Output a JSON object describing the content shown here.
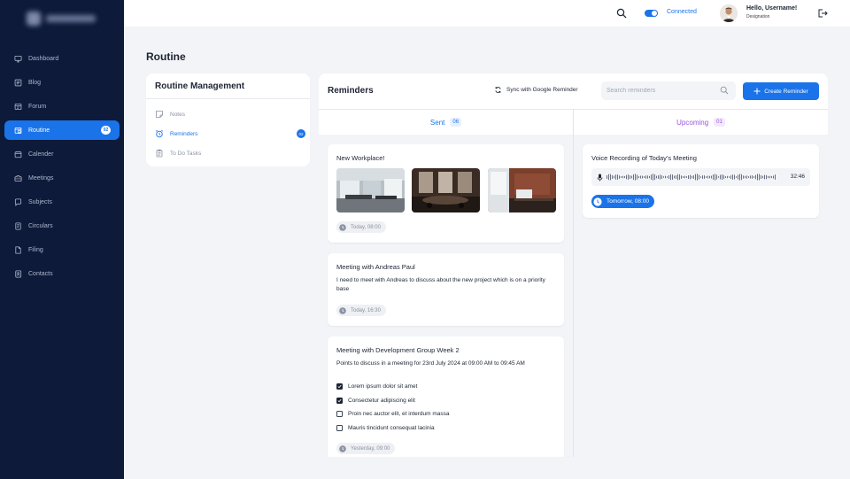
{
  "sidebar": {
    "items": [
      {
        "label": "Dashboard"
      },
      {
        "label": "Blog"
      },
      {
        "label": "Forum"
      },
      {
        "label": "Routine",
        "badge": "02"
      },
      {
        "label": "Calender"
      },
      {
        "label": "Meetings"
      },
      {
        "label": "Subjects"
      },
      {
        "label": "Circulars"
      },
      {
        "label": "Filing"
      },
      {
        "label": "Contacts"
      }
    ]
  },
  "topbar": {
    "status": "Connected",
    "user_greeting": "Hello, Username!",
    "user_role": "Designation"
  },
  "page": {
    "title": "Routine"
  },
  "routine_mgmt": {
    "title": "Routine Management",
    "items": [
      {
        "label": "Notes"
      },
      {
        "label": "Reminders",
        "badge": "02"
      },
      {
        "label": "To Do Tasks"
      }
    ]
  },
  "reminders": {
    "title": "Reminders",
    "sync_label": "Sync with Google Reminder",
    "search_placeholder": "Search reminders",
    "create_label": "Create Reminder",
    "sent": {
      "label": "Sent",
      "count": "06",
      "cards": [
        {
          "title": "New Workplace!",
          "time": "Today, 08:00"
        },
        {
          "title": "Meeting with Andreas Paul",
          "body": "I need to meet with Andreas to discuss about the new project which is on a priority base",
          "time": "Today, 16:30"
        },
        {
          "title": "Meeting with Development Group Week 2",
          "body": "Points to discuss in a meeting for 23rd July 2024 at 09:00 AM to 09:45 AM",
          "time": "Yesterday, 09:00",
          "checklist": [
            {
              "text": "Lorem ipsum dolor sit amet",
              "checked": true
            },
            {
              "text": "Consectetur adipiscing elit",
              "checked": true
            },
            {
              "text": "Proin nec auctor elit, et interdum massa",
              "checked": false
            },
            {
              "text": "Mauris tincidunt consequat lacinia",
              "checked": false
            }
          ]
        }
      ]
    },
    "upcoming": {
      "label": "Upcoming",
      "count": "01",
      "cards": [
        {
          "title": "Voice Recording of Today's Meeting",
          "duration": "32:46",
          "time": "Tomorrow, 08:00"
        }
      ]
    }
  },
  "colors": {
    "accent": "#1a73e8",
    "sidebar_bg": "#0d1a3a",
    "upcoming": "#9b51e0"
  }
}
